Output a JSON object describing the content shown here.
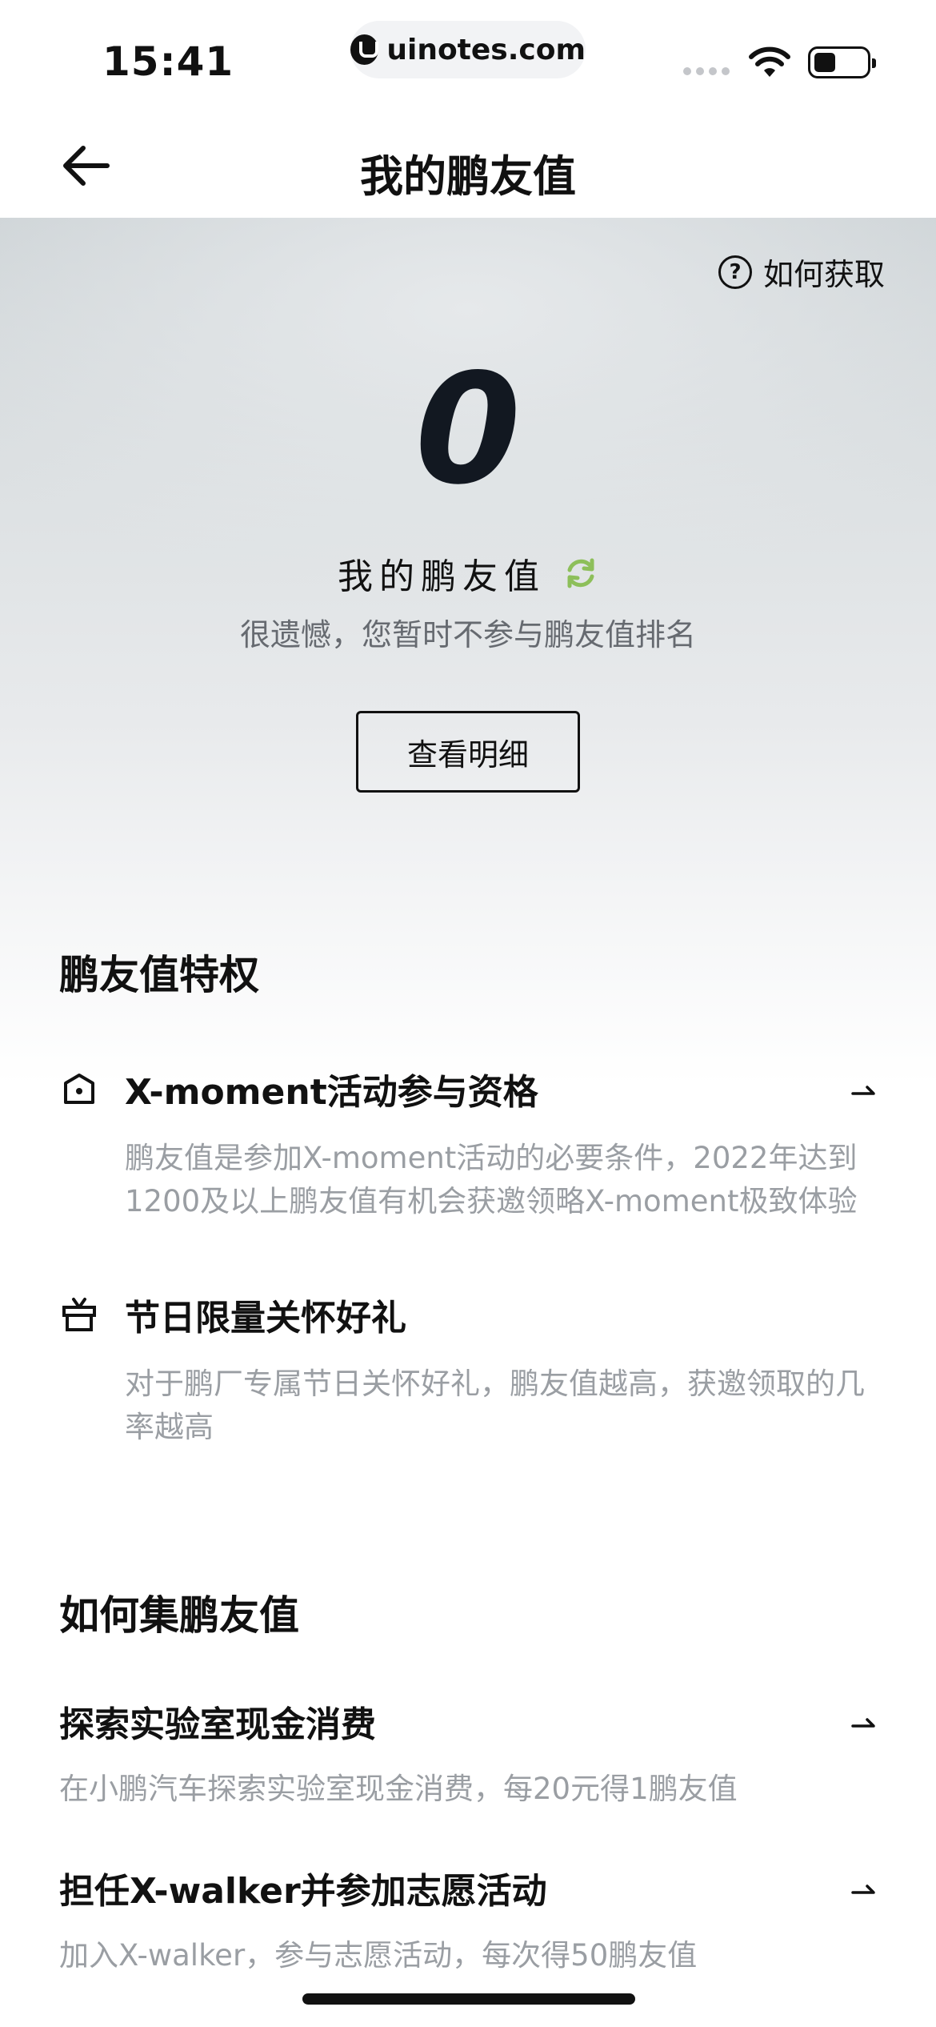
{
  "status_bar": {
    "time": "15:41",
    "url": "uinotes.com"
  },
  "nav": {
    "title": "我的鹏友值",
    "back_icon": "arrow-left-icon"
  },
  "hero": {
    "how_to_get": "如何获取",
    "score": "0",
    "score_label": "我的鹏友值",
    "rank_note": "很遗憾，您暂时不参与鹏友值排名",
    "detail_button": "查看明细",
    "refresh_color": "#8dbf5a"
  },
  "privileges": {
    "title": "鹏友值特权",
    "items": [
      {
        "icon": "crown-icon",
        "title": "X-moment活动参与资格",
        "desc": "鹏友值是参加X-moment活动的必要条件，2022年达到1200及以上鹏友值有机会获邀领略X-moment极致体验"
      },
      {
        "icon": "gift-icon",
        "title": "节日限量关怀好礼",
        "desc": "对于鹏厂专属节日关怀好礼，鹏友值越高，获邀领取的几率越高"
      }
    ]
  },
  "ways": {
    "title": "如何集鹏友值",
    "items": [
      {
        "title": "探索实验室现金消费",
        "desc": "在小鹏汽车探索实验室现金消费，每20元得1鹏友值"
      },
      {
        "title": "担任X-walker并参加志愿活动",
        "desc": "加入X-walker，参与志愿活动，每次得50鹏友值"
      }
    ]
  }
}
